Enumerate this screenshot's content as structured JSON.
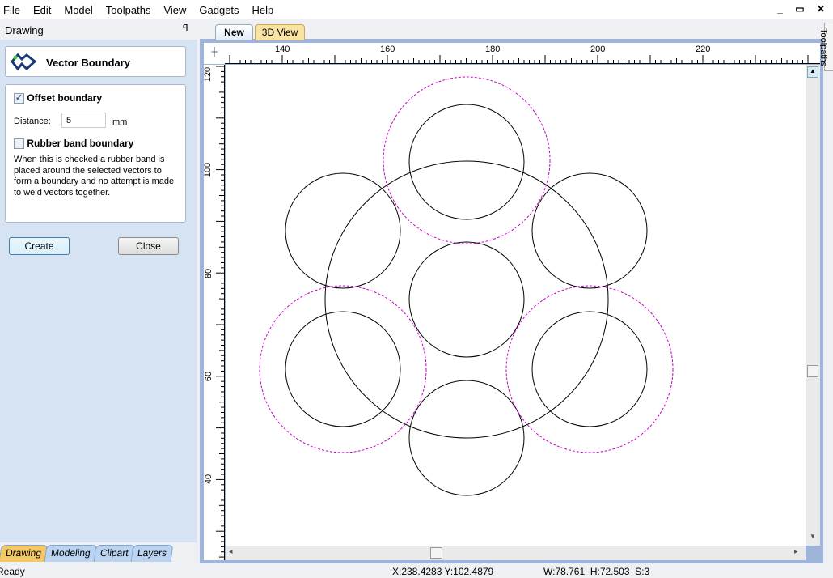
{
  "menu": [
    "File",
    "Edit",
    "Model",
    "Toolpaths",
    "View",
    "Gadgets",
    "Help"
  ],
  "window_controls": "_ ▭ ✕",
  "panel": {
    "title": "Drawing",
    "pin_icon": "pin-icon",
    "tool_name": "Vector Boundary",
    "offset_label": "Offset boundary",
    "offset_checked": true,
    "distance_label": "Distance:",
    "distance_value": "5",
    "distance_unit": "mm",
    "rubber_label": "Rubber band boundary",
    "rubber_checked": false,
    "help": "When this is checked a rubber band is placed around the selected vectors to form a boundary and no attempt is made to weld vectors together.",
    "create": "Create",
    "close": "Close"
  },
  "bottom_tabs": [
    {
      "label": "Drawing",
      "active": true
    },
    {
      "label": "Modeling"
    },
    {
      "label": "Clipart"
    },
    {
      "label": "Layers"
    }
  ],
  "doc_tabs": {
    "new": "New",
    "view3d": "3D View"
  },
  "side_tab": "Toolpaths",
  "ruler": {
    "top": [
      "140",
      "160",
      "180",
      "200",
      "220"
    ],
    "left": [
      "120",
      "100",
      "80",
      "60",
      "40"
    ]
  },
  "status": {
    "left": "Ready",
    "coords": "X:238.4283 Y:102.4879",
    "size": "W:78.761  H:72.503  S:3"
  },
  "colors": {
    "offset_boundary": "#cc00cc",
    "vectors": "#000000"
  }
}
